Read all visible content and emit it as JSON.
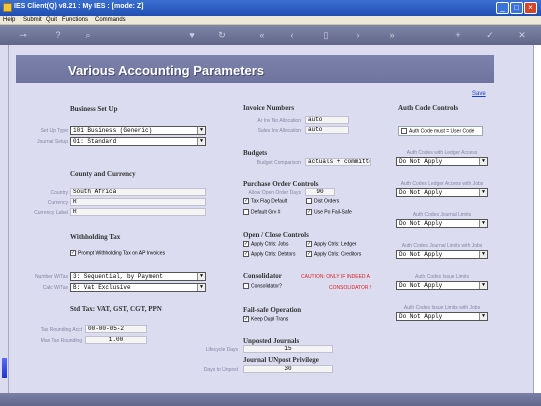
{
  "window": {
    "title": "IES Client(Q) v8.21 : My IES :     [mode: Z]",
    "min": "_",
    "max": "□",
    "close": "×"
  },
  "menu": [
    "Help",
    "Submit",
    "Quit",
    "Functions",
    "Commands"
  ],
  "toolbar_icons": [
    "key-icon",
    "help-icon",
    "search-icon",
    "heart-icon",
    "refresh-icon",
    "rewind-icon",
    "back-icon",
    "doc-icon",
    "forward-icon",
    "fast-forward-icon",
    "add-icon",
    "check-icon",
    "cancel-icon"
  ],
  "page": {
    "title": "Various Accounting Parameters",
    "save_link": "Save"
  },
  "business_setup": {
    "heading": "Business Set Up",
    "setup_type_label": "Set Up Type",
    "setup_type": "101 Business (Generic)",
    "journal_setup_label": "Journal Setup",
    "journal_setup": "01: Standard"
  },
  "country_currency": {
    "heading": "County and Currency",
    "country_label": "Country",
    "country": "South Africa",
    "currency_label": "Currency",
    "currency": "R",
    "currency_label_label": "Currency Label",
    "currency_label_value": "R"
  },
  "withholding": {
    "heading": "Withholding Tax",
    "prompt_label": "Prompt Withholding Tax on AP Invoices",
    "prompt_checked": true
  },
  "numbering": {
    "number_wf_label": "Number W/Tax",
    "number_wf": "3: Sequential, by Payment",
    "calc_wf_label": "Calc W/Tax",
    "calc_wf": "B: Vat Exclusive"
  },
  "std_tax": {
    "heading": "Std Tax: VAT, GST, CGT, PPN",
    "rounding_acct_label": "Tax Rounding Acct",
    "rounding_acct": "00-00-05-2",
    "rounding_label": "Max Tax Rounding",
    "rounding": "1.00"
  },
  "invoice_numbers": {
    "heading": "Invoice Numbers",
    "ar_label": "Ar Inv No Allocation",
    "ar": "auto",
    "sales_label": "Sales Inv Allocation",
    "sales": "auto"
  },
  "budgets": {
    "heading": "Budgets",
    "comparison_label": "Budget Comparison",
    "comparison": "actuals + committe"
  },
  "purchase_order": {
    "heading": "Purchase Order Controls",
    "open_days_label": "Allow Open Order Days",
    "open_days": "90",
    "tax_flag": "Tax Flag Default",
    "tax_flag_checked": true,
    "dist_orders": "Dist Orders",
    "dist_orders_checked": false,
    "default_grv": "Default Grv #",
    "default_grv_checked": false,
    "use_po": "Use Po Fail-Safe",
    "use_po_checked": true
  },
  "open_close": {
    "heading": "Open / Close Controls",
    "jobs": "Apply Ctrls: Jobs",
    "jobs_checked": true,
    "ledger": "Apply Ctrls: Ledger",
    "ledger_checked": true,
    "debtors": "Apply Ctrls: Debtors",
    "debtors_checked": true,
    "creditors": "Apply Ctrls: Creditors",
    "creditors_checked": true
  },
  "consolidator": {
    "heading": "Consolidator",
    "check_label": "Consolidator?",
    "checked": false,
    "warning_1": "CAUTION: ONLY IF INDEED A",
    "warning_2": "CONSOLIDATOR !"
  },
  "failsafe": {
    "heading": "Fail-safe Operation",
    "keep_label": "Keep Dupl Trans",
    "keep_checked": true
  },
  "unposted": {
    "heading": "Unposted Journals",
    "days_label": "Lifecycle Days",
    "days": "15"
  },
  "unpost_priv": {
    "heading": "Journal UNpost Privilege",
    "days_label": "Days to Unpost",
    "days": "30"
  },
  "auth": {
    "heading": "Auth Code Controls",
    "must_user_label": "Auth Code must = User Code",
    "must_user_checked": false,
    "ledger_access_label": "Auth Codes with Ledger Access",
    "ledger_access": "Do Not Apply",
    "ledger_jobs_label": "Auth Codes Ledger Access with Jobs",
    "ledger_jobs": "Do Not Apply",
    "journal_limits_label": "Auth Codes Journal Limits",
    "journal_limits": "Do Not Apply",
    "journal_jobs_label": "Auth Codes Journal Limits with Jobs",
    "journal_jobs": "Do Not Apply",
    "issue_limits_label": "Auth Codes Issue Limits",
    "issue_limits": "Do Not Apply",
    "issue_jobs_label": "Auth Codes Issue Limits with Jobs",
    "issue_jobs": "Do Not Apply"
  }
}
